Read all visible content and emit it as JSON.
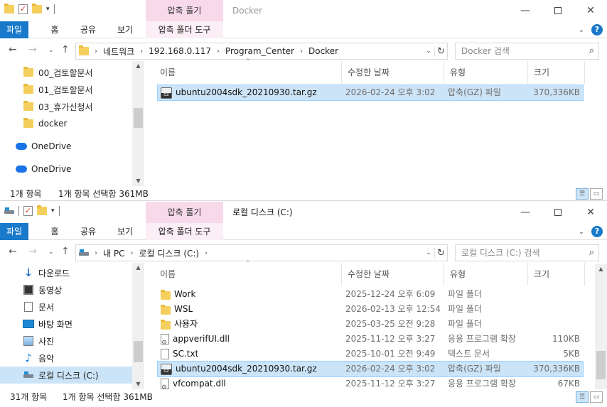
{
  "window1": {
    "title": "Docker",
    "context_tab": "압축 풀기",
    "ribbon_tabs": [
      "파일",
      "홈",
      "공유",
      "보기",
      "압축 폴더 도구"
    ],
    "breadcrumb": [
      "네트워크",
      "192.168.0.117",
      "Program_Center",
      "Docker"
    ],
    "search_placeholder": "Docker 검색",
    "nav_items": [
      {
        "label": "00_검토할문서",
        "icon": "folder-icon"
      },
      {
        "label": "01_검토할문서",
        "icon": "folder-icon"
      },
      {
        "label": "03_휴가신청서",
        "icon": "folder-icon"
      },
      {
        "label": "docker",
        "icon": "folder-icon"
      },
      {
        "label": "OneDrive",
        "icon": "onedrive-icon"
      },
      {
        "label": "OneDrive",
        "icon": "onedrive-icon"
      }
    ],
    "columns": {
      "name": "이름",
      "date": "수정한 날짜",
      "type": "유형",
      "size": "크기"
    },
    "files": [
      {
        "name": "ubuntu2004sdk_20210930.tar.gz",
        "date": "2026-02-24 오후 3:02",
        "type": "압축(GZ) 파일",
        "size": "370,336KB",
        "icon": "gz-archive-icon",
        "selected": true
      }
    ],
    "status_count": "1개 항목",
    "status_selected": "1개 항목 선택함 361MB"
  },
  "window2": {
    "title": "로컬 디스크 (C:)",
    "context_tab": "압축 풀기",
    "ribbon_tabs": [
      "파일",
      "홈",
      "공유",
      "보기",
      "압축 폴더 도구"
    ],
    "breadcrumb": [
      "내 PC",
      "로컬 디스크 (C:)"
    ],
    "search_placeholder": "로컬 디스크 (C:) 검색",
    "nav_items": [
      {
        "label": "다운로드",
        "icon": "download-icon"
      },
      {
        "label": "동영상",
        "icon": "video-icon"
      },
      {
        "label": "문서",
        "icon": "documents-icon"
      },
      {
        "label": "바탕 화면",
        "icon": "desktop-icon"
      },
      {
        "label": "사진",
        "icon": "pictures-icon"
      },
      {
        "label": "음악",
        "icon": "music-icon"
      },
      {
        "label": "로컬 디스크 (C:)",
        "icon": "drive-icon",
        "selected": true
      }
    ],
    "columns": {
      "name": "이름",
      "date": "수정한 날짜",
      "type": "유형",
      "size": "크기"
    },
    "files": [
      {
        "name": "Work",
        "date": "2025-12-24 오후 6:09",
        "type": "파일 폴더",
        "size": "",
        "icon": "folder-icon"
      },
      {
        "name": "WSL",
        "date": "2026-02-13 오후 12:54",
        "type": "파일 폴더",
        "size": "",
        "icon": "folder-icon"
      },
      {
        "name": "사용자",
        "date": "2025-03-25 오전 9:28",
        "type": "파일 폴더",
        "size": "",
        "icon": "folder-icon"
      },
      {
        "name": "appverifUI.dll",
        "date": "2025-11-12 오후 3:27",
        "type": "응용 프로그램 확장",
        "size": "110KB",
        "icon": "dll-icon"
      },
      {
        "name": "SC.txt",
        "date": "2025-10-01 오전 9:49",
        "type": "텍스트 문서",
        "size": "5KB",
        "icon": "text-file-icon"
      },
      {
        "name": "ubuntu2004sdk_20210930.tar.gz",
        "date": "2026-02-24 오후 3:02",
        "type": "압축(GZ) 파일",
        "size": "370,336KB",
        "icon": "gz-archive-icon",
        "selected": true
      },
      {
        "name": "vfcompat.dll",
        "date": "2025-11-12 오후 3:27",
        "type": "응용 프로그램 확장",
        "size": "67KB",
        "icon": "dll-icon"
      }
    ],
    "status_count": "31개 항목",
    "status_selected": "1개 항목 선택함 361MB"
  }
}
